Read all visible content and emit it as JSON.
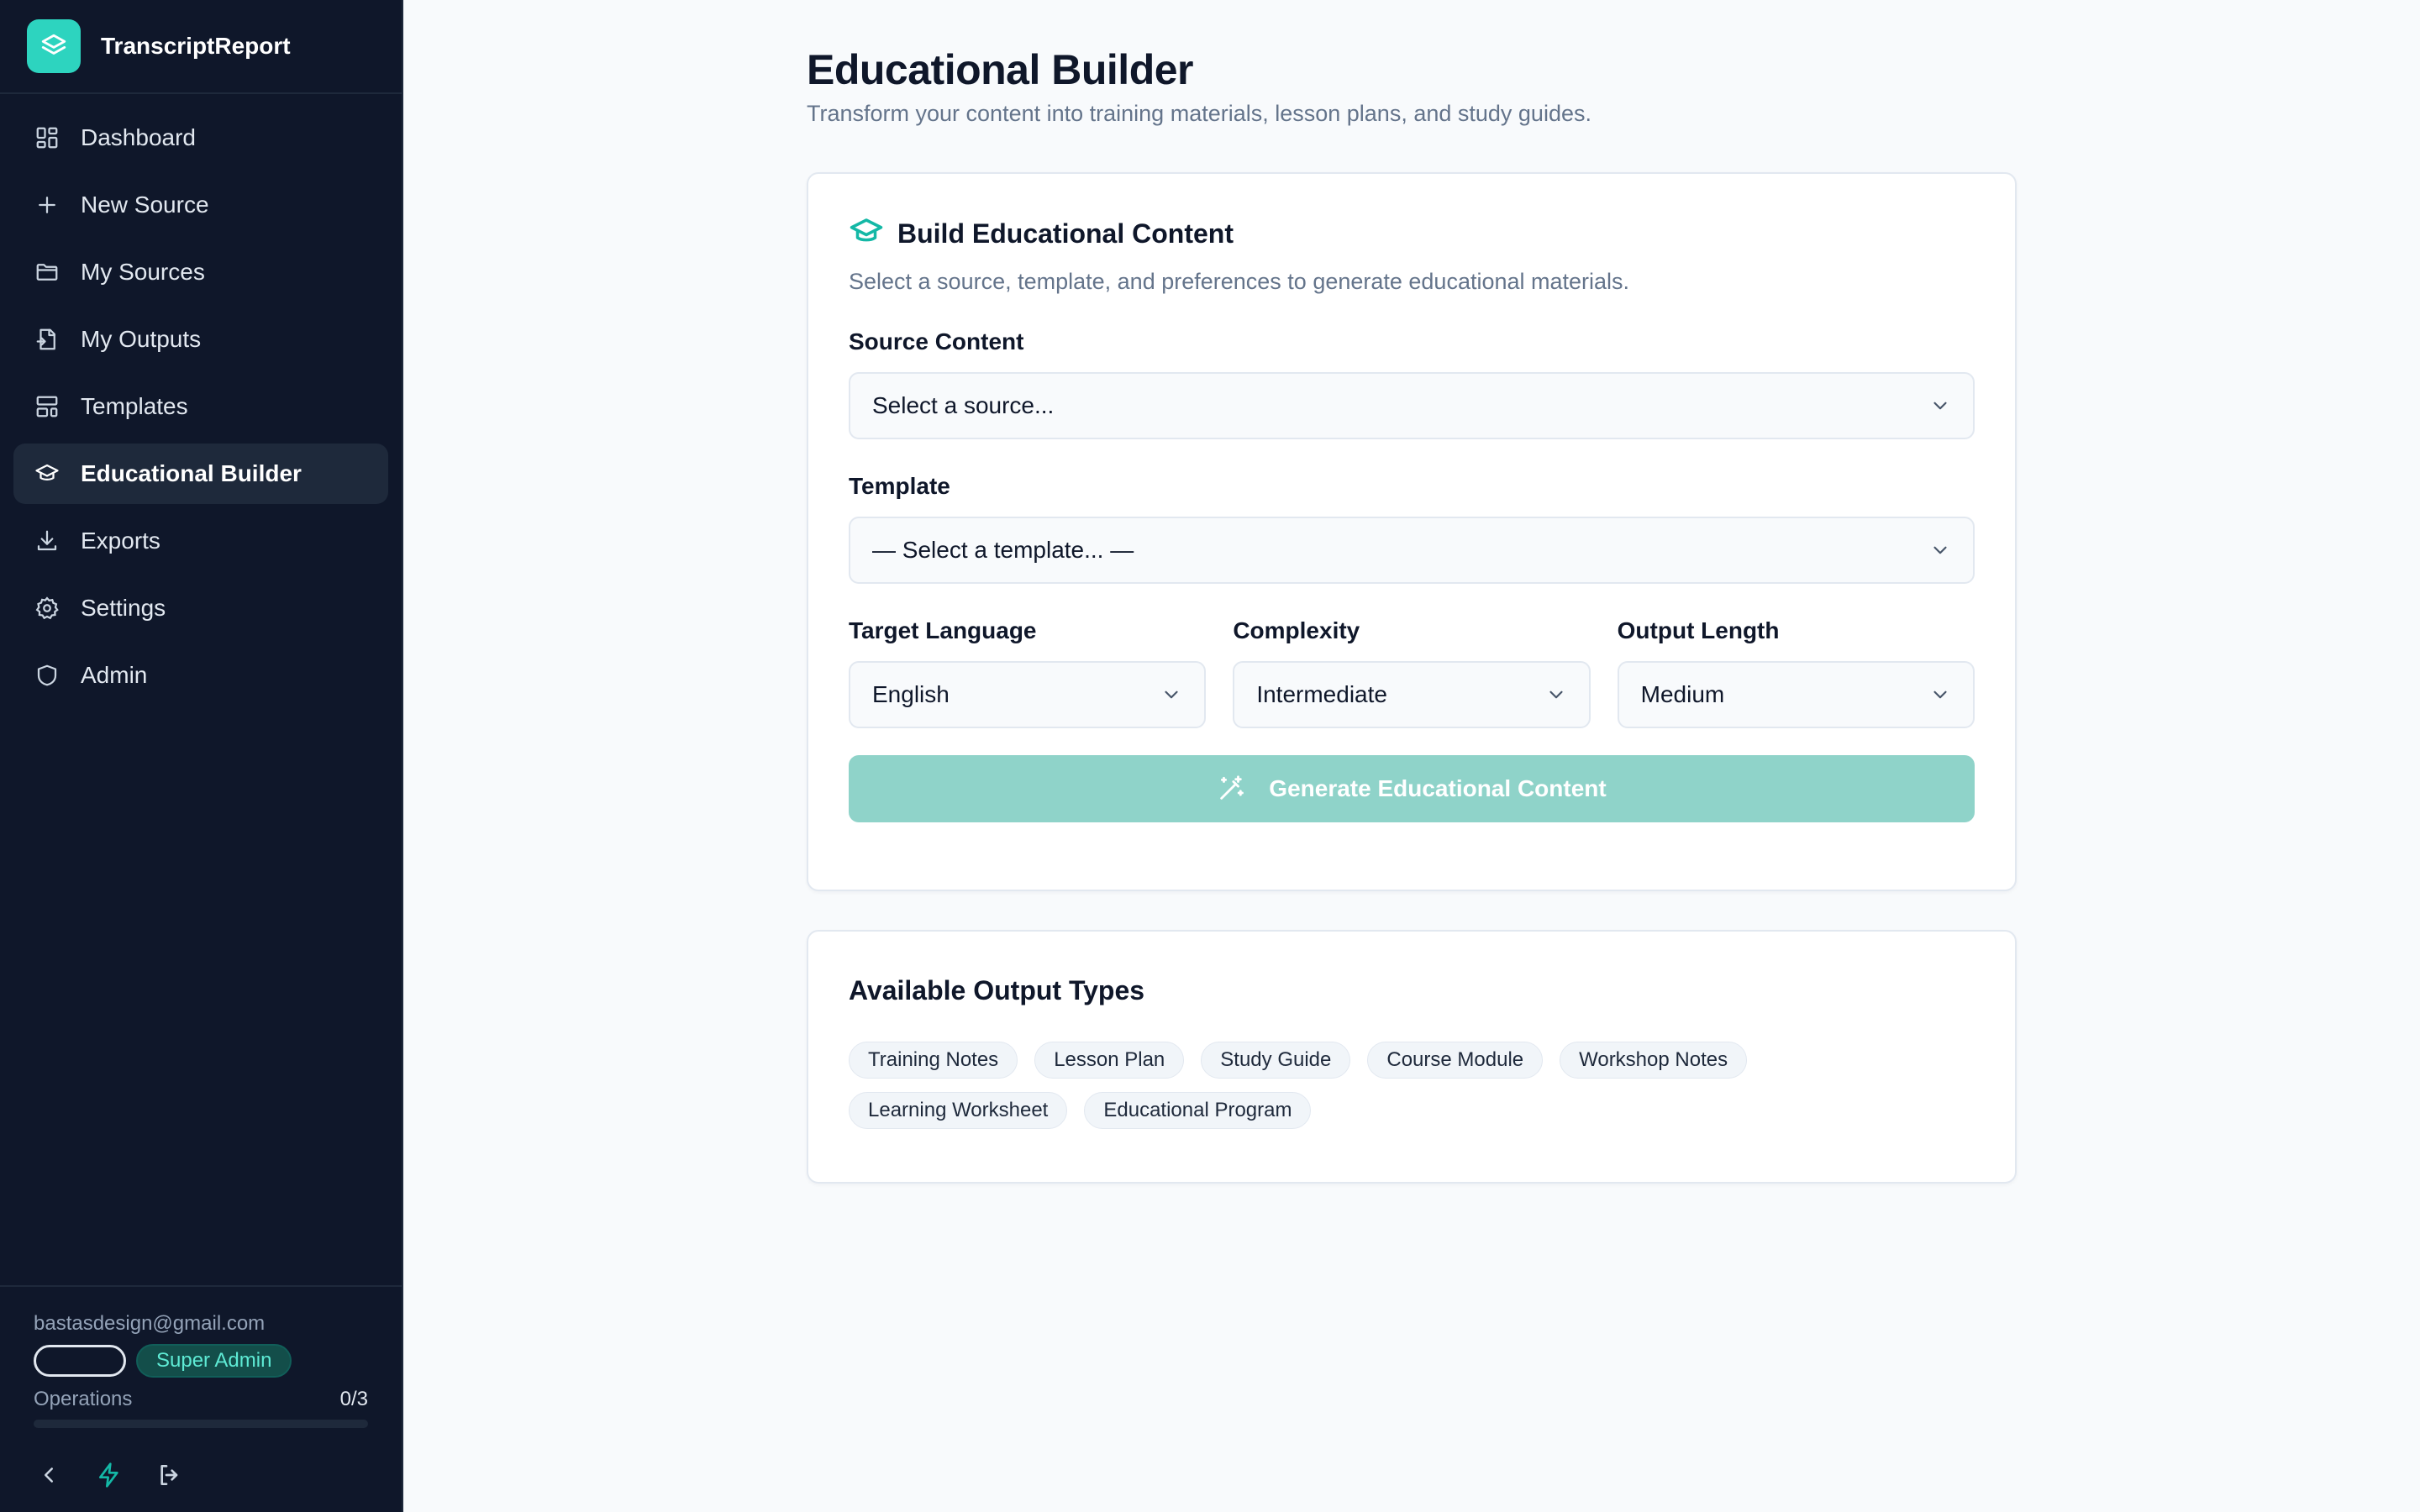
{
  "app": {
    "name": "TranscriptReport"
  },
  "sidebar": {
    "items": [
      {
        "label": "Dashboard",
        "icon": "dashboard-icon",
        "active": false
      },
      {
        "label": "New Source",
        "icon": "plus-icon",
        "active": false
      },
      {
        "label": "My Sources",
        "icon": "folder-icon",
        "active": false
      },
      {
        "label": "My Outputs",
        "icon": "file-output-icon",
        "active": false
      },
      {
        "label": "Templates",
        "icon": "layout-template-icon",
        "active": false
      },
      {
        "label": "Educational Builder",
        "icon": "graduation-cap-icon",
        "active": true
      },
      {
        "label": "Exports",
        "icon": "download-icon",
        "active": false
      },
      {
        "label": "Settings",
        "icon": "gear-icon",
        "active": false
      },
      {
        "label": "Admin",
        "icon": "shield-icon",
        "active": false
      }
    ],
    "footer": {
      "email": "bastasdesign@gmail.com",
      "role": "Super Admin",
      "operations_label": "Operations",
      "operations_value": "0/3",
      "operations_fraction": 0
    }
  },
  "page": {
    "title": "Educational Builder",
    "subtitle": "Transform your content into training materials, lesson plans, and study guides."
  },
  "builder": {
    "title": "Build Educational Content",
    "description": "Select a source, template, and preferences to generate educational materials.",
    "source_label": "Source Content",
    "source_value": "Select a source...",
    "template_label": "Template",
    "template_value": "— Select a template... —",
    "language_label": "Target Language",
    "language_value": "English",
    "complexity_label": "Complexity",
    "complexity_value": "Intermediate",
    "length_label": "Output Length",
    "length_value": "Medium",
    "generate_label": "Generate Educational Content"
  },
  "output_types": {
    "title": "Available Output Types",
    "items": [
      "Training Notes",
      "Lesson Plan",
      "Study Guide",
      "Course Module",
      "Workshop Notes",
      "Learning Worksheet",
      "Educational Program"
    ]
  },
  "colors": {
    "accent": "#2dd4bf",
    "sidebar_bg": "#0f172a",
    "button_disabled": "#8fd3c9"
  }
}
